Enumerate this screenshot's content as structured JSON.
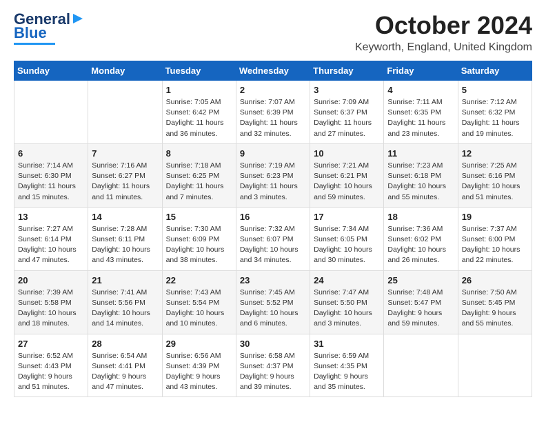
{
  "logo": {
    "line1": "General",
    "line2": "Blue"
  },
  "header": {
    "month": "October 2024",
    "location": "Keyworth, England, United Kingdom"
  },
  "weekdays": [
    "Sunday",
    "Monday",
    "Tuesday",
    "Wednesday",
    "Thursday",
    "Friday",
    "Saturday"
  ],
  "weeks": [
    [
      {
        "day": "",
        "info": ""
      },
      {
        "day": "",
        "info": ""
      },
      {
        "day": "1",
        "info": "Sunrise: 7:05 AM\nSunset: 6:42 PM\nDaylight: 11 hours\nand 36 minutes."
      },
      {
        "day": "2",
        "info": "Sunrise: 7:07 AM\nSunset: 6:39 PM\nDaylight: 11 hours\nand 32 minutes."
      },
      {
        "day": "3",
        "info": "Sunrise: 7:09 AM\nSunset: 6:37 PM\nDaylight: 11 hours\nand 27 minutes."
      },
      {
        "day": "4",
        "info": "Sunrise: 7:11 AM\nSunset: 6:35 PM\nDaylight: 11 hours\nand 23 minutes."
      },
      {
        "day": "5",
        "info": "Sunrise: 7:12 AM\nSunset: 6:32 PM\nDaylight: 11 hours\nand 19 minutes."
      }
    ],
    [
      {
        "day": "6",
        "info": "Sunrise: 7:14 AM\nSunset: 6:30 PM\nDaylight: 11 hours\nand 15 minutes."
      },
      {
        "day": "7",
        "info": "Sunrise: 7:16 AM\nSunset: 6:27 PM\nDaylight: 11 hours\nand 11 minutes."
      },
      {
        "day": "8",
        "info": "Sunrise: 7:18 AM\nSunset: 6:25 PM\nDaylight: 11 hours\nand 7 minutes."
      },
      {
        "day": "9",
        "info": "Sunrise: 7:19 AM\nSunset: 6:23 PM\nDaylight: 11 hours\nand 3 minutes."
      },
      {
        "day": "10",
        "info": "Sunrise: 7:21 AM\nSunset: 6:21 PM\nDaylight: 10 hours\nand 59 minutes."
      },
      {
        "day": "11",
        "info": "Sunrise: 7:23 AM\nSunset: 6:18 PM\nDaylight: 10 hours\nand 55 minutes."
      },
      {
        "day": "12",
        "info": "Sunrise: 7:25 AM\nSunset: 6:16 PM\nDaylight: 10 hours\nand 51 minutes."
      }
    ],
    [
      {
        "day": "13",
        "info": "Sunrise: 7:27 AM\nSunset: 6:14 PM\nDaylight: 10 hours\nand 47 minutes."
      },
      {
        "day": "14",
        "info": "Sunrise: 7:28 AM\nSunset: 6:11 PM\nDaylight: 10 hours\nand 43 minutes."
      },
      {
        "day": "15",
        "info": "Sunrise: 7:30 AM\nSunset: 6:09 PM\nDaylight: 10 hours\nand 38 minutes."
      },
      {
        "day": "16",
        "info": "Sunrise: 7:32 AM\nSunset: 6:07 PM\nDaylight: 10 hours\nand 34 minutes."
      },
      {
        "day": "17",
        "info": "Sunrise: 7:34 AM\nSunset: 6:05 PM\nDaylight: 10 hours\nand 30 minutes."
      },
      {
        "day": "18",
        "info": "Sunrise: 7:36 AM\nSunset: 6:02 PM\nDaylight: 10 hours\nand 26 minutes."
      },
      {
        "day": "19",
        "info": "Sunrise: 7:37 AM\nSunset: 6:00 PM\nDaylight: 10 hours\nand 22 minutes."
      }
    ],
    [
      {
        "day": "20",
        "info": "Sunrise: 7:39 AM\nSunset: 5:58 PM\nDaylight: 10 hours\nand 18 minutes."
      },
      {
        "day": "21",
        "info": "Sunrise: 7:41 AM\nSunset: 5:56 PM\nDaylight: 10 hours\nand 14 minutes."
      },
      {
        "day": "22",
        "info": "Sunrise: 7:43 AM\nSunset: 5:54 PM\nDaylight: 10 hours\nand 10 minutes."
      },
      {
        "day": "23",
        "info": "Sunrise: 7:45 AM\nSunset: 5:52 PM\nDaylight: 10 hours\nand 6 minutes."
      },
      {
        "day": "24",
        "info": "Sunrise: 7:47 AM\nSunset: 5:50 PM\nDaylight: 10 hours\nand 3 minutes."
      },
      {
        "day": "25",
        "info": "Sunrise: 7:48 AM\nSunset: 5:47 PM\nDaylight: 9 hours\nand 59 minutes."
      },
      {
        "day": "26",
        "info": "Sunrise: 7:50 AM\nSunset: 5:45 PM\nDaylight: 9 hours\nand 55 minutes."
      }
    ],
    [
      {
        "day": "27",
        "info": "Sunrise: 6:52 AM\nSunset: 4:43 PM\nDaylight: 9 hours\nand 51 minutes."
      },
      {
        "day": "28",
        "info": "Sunrise: 6:54 AM\nSunset: 4:41 PM\nDaylight: 9 hours\nand 47 minutes."
      },
      {
        "day": "29",
        "info": "Sunrise: 6:56 AM\nSunset: 4:39 PM\nDaylight: 9 hours\nand 43 minutes."
      },
      {
        "day": "30",
        "info": "Sunrise: 6:58 AM\nSunset: 4:37 PM\nDaylight: 9 hours\nand 39 minutes."
      },
      {
        "day": "31",
        "info": "Sunrise: 6:59 AM\nSunset: 4:35 PM\nDaylight: 9 hours\nand 35 minutes."
      },
      {
        "day": "",
        "info": ""
      },
      {
        "day": "",
        "info": ""
      }
    ]
  ]
}
